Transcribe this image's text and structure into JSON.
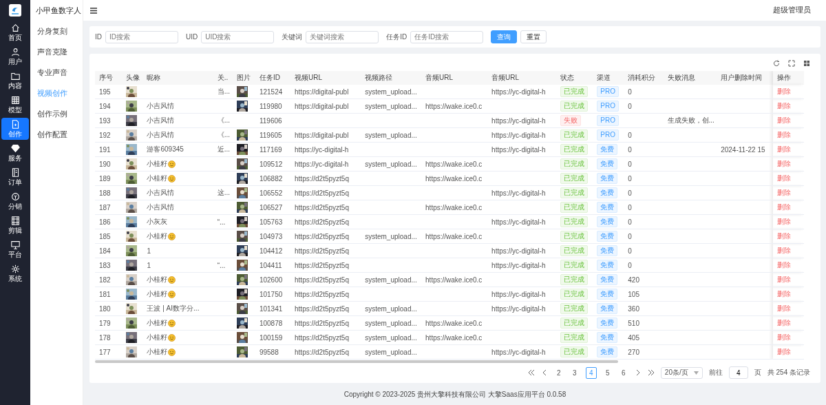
{
  "brand": {
    "title": "小甲鱼数字人"
  },
  "nav": [
    {
      "label": "首页",
      "kind": "home",
      "selected": false
    },
    {
      "label": "用户",
      "kind": "user",
      "selected": false
    },
    {
      "label": "内容",
      "kind": "folder",
      "selected": false
    },
    {
      "label": "模型",
      "kind": "grid",
      "selected": false
    },
    {
      "label": "创作",
      "kind": "doc",
      "selected": true
    },
    {
      "label": "服务",
      "kind": "diamond",
      "selected": false
    },
    {
      "label": "订单",
      "kind": "book",
      "selected": false
    },
    {
      "label": "分销",
      "kind": "coin",
      "selected": false
    },
    {
      "label": "剪辑",
      "kind": "film",
      "selected": false
    },
    {
      "label": "平台",
      "kind": "monitor",
      "selected": false
    },
    {
      "label": "系统",
      "kind": "gear",
      "selected": false
    }
  ],
  "submenu": [
    {
      "label": "分身复刻",
      "selected": false
    },
    {
      "label": "声音克隆",
      "selected": false
    },
    {
      "label": "专业声音",
      "selected": false
    },
    {
      "label": "视频创作",
      "selected": true
    },
    {
      "label": "创作示例",
      "selected": false
    },
    {
      "label": "创作配置",
      "selected": false
    }
  ],
  "user": {
    "name": "超级管理员"
  },
  "filters": [
    {
      "label": "ID",
      "placeholder": "ID搜索"
    },
    {
      "label": "UID",
      "placeholder": "UID搜索"
    },
    {
      "label": "关键词",
      "placeholder": "关键词搜索"
    },
    {
      "label": "任务ID",
      "placeholder": "任务ID搜索"
    }
  ],
  "buttons": [
    {
      "label": "查询",
      "kind": "primary"
    },
    {
      "label": "重置",
      "kind": "plain"
    }
  ],
  "table": {
    "columns": [
      "序号",
      "头像",
      "昵称",
      "关..",
      "图片",
      "任务ID",
      "视频URL",
      "视频路径",
      "音频URL",
      "音频URL",
      "状态",
      "渠道",
      "消耗积分",
      "失败消息",
      "用户删除时间",
      "操作"
    ],
    "rows": [
      {
        "no": "195",
        "nick": "",
        "emoji": false,
        "rel": "当...",
        "image": true,
        "task": "121524",
        "video_url": "https://digital-publ",
        "video_path": "system_upload...",
        "audio_url": "",
        "audio_url_2": "https://yc-digital-h",
        "status": {
          "kind": "done",
          "label": "已完成"
        },
        "channel": "PRO",
        "credits": "0",
        "fail": "",
        "deleted": "",
        "action": "删除"
      },
      {
        "no": "194",
        "nick": "小吉风情",
        "emoji": false,
        "rel": "",
        "image": true,
        "task": "119980",
        "video_url": "https://digital-publ",
        "video_path": "system_upload...",
        "audio_url": "https://wake.ice0.c",
        "audio_url_2": "",
        "status": {
          "kind": "done",
          "label": "已完成"
        },
        "channel": "PRO",
        "credits": "0",
        "fail": "",
        "deleted": "",
        "action": "删除"
      },
      {
        "no": "193",
        "nick": "小吉风情",
        "emoji": false,
        "rel": "《...",
        "image": false,
        "task": "119606",
        "video_url": "",
        "video_path": "",
        "audio_url": "",
        "audio_url_2": "https://yc-digital-h",
        "status": {
          "kind": "failed",
          "label": "失败"
        },
        "channel": "PRO",
        "credits": "",
        "fail": "生成失败，创...",
        "deleted": "",
        "action": "删除"
      },
      {
        "no": "192",
        "nick": "小吉风情",
        "emoji": false,
        "rel": "《...",
        "image": true,
        "task": "119605",
        "video_url": "https://digital-publ",
        "video_path": "system_upload...",
        "audio_url": "",
        "audio_url_2": "https://yc-digital-h",
        "status": {
          "kind": "done",
          "label": "已完成"
        },
        "channel": "PRO",
        "credits": "0",
        "fail": "",
        "deleted": "",
        "action": "删除"
      },
      {
        "no": "191",
        "nick": "游客609345",
        "emoji": false,
        "rel": "近...",
        "image": true,
        "task": "117169",
        "video_url": "https://yc-digital-h",
        "video_path": "",
        "audio_url": "",
        "audio_url_2": "https://yc-digital-h",
        "status": {
          "kind": "done",
          "label": "已完成"
        },
        "channel": "免费",
        "credits": "0",
        "fail": "",
        "deleted": "2024-11-22 15",
        "action": "删除"
      },
      {
        "no": "190",
        "nick": "小桂籽",
        "emoji": true,
        "rel": "",
        "image": true,
        "task": "109512",
        "video_url": "https://yc-digital-h",
        "video_path": "system_upload...",
        "audio_url": "https://wake.ice0.c",
        "audio_url_2": "",
        "status": {
          "kind": "done",
          "label": "已完成"
        },
        "channel": "免费",
        "credits": "0",
        "fail": "",
        "deleted": "",
        "action": "删除"
      },
      {
        "no": "189",
        "nick": "小桂籽",
        "emoji": true,
        "rel": "",
        "image": true,
        "task": "106882",
        "video_url": "https://d2t5pyzt5q",
        "video_path": "",
        "audio_url": "https://wake.ice0.c",
        "audio_url_2": "",
        "status": {
          "kind": "done",
          "label": "已完成"
        },
        "channel": "免费",
        "credits": "0",
        "fail": "",
        "deleted": "",
        "action": "删除"
      },
      {
        "no": "188",
        "nick": "小吉风情",
        "emoji": false,
        "rel": "这...",
        "image": true,
        "task": "106552",
        "video_url": "https://d2t5pyzt5q",
        "video_path": "",
        "audio_url": "",
        "audio_url_2": "https://yc-digital-h",
        "status": {
          "kind": "done",
          "label": "已完成"
        },
        "channel": "免费",
        "credits": "0",
        "fail": "",
        "deleted": "",
        "action": "删除"
      },
      {
        "no": "187",
        "nick": "小吉风情",
        "emoji": false,
        "rel": "",
        "image": true,
        "task": "106527",
        "video_url": "https://d2t5pyzt5q",
        "video_path": "",
        "audio_url": "https://wake.ice0.c",
        "audio_url_2": "",
        "status": {
          "kind": "done",
          "label": "已完成"
        },
        "channel": "免费",
        "credits": "0",
        "fail": "",
        "deleted": "",
        "action": "删除"
      },
      {
        "no": "186",
        "nick": "小灰灰",
        "emoji": false,
        "rel": "“...",
        "image": true,
        "task": "105763",
        "video_url": "https://d2t5pyzt5q",
        "video_path": "",
        "audio_url": "",
        "audio_url_2": "https://yc-digital-h",
        "status": {
          "kind": "done",
          "label": "已完成"
        },
        "channel": "免费",
        "credits": "0",
        "fail": "",
        "deleted": "",
        "action": "删除"
      },
      {
        "no": "185",
        "nick": "小桂籽",
        "emoji": true,
        "rel": "",
        "image": true,
        "task": "104973",
        "video_url": "https://d2t5pyzt5q",
        "video_path": "system_upload...",
        "audio_url": "https://wake.ice0.c",
        "audio_url_2": "",
        "status": {
          "kind": "done",
          "label": "已完成"
        },
        "channel": "免费",
        "credits": "0",
        "fail": "",
        "deleted": "",
        "action": "删除"
      },
      {
        "no": "184",
        "nick": "1",
        "emoji": false,
        "rel": "",
        "image": true,
        "task": "104412",
        "video_url": "https://d2t5pyzt5q",
        "video_path": "",
        "audio_url": "",
        "audio_url_2": "https://yc-digital-h",
        "status": {
          "kind": "done",
          "label": "已完成"
        },
        "channel": "免费",
        "credits": "0",
        "fail": "",
        "deleted": "",
        "action": "删除"
      },
      {
        "no": "183",
        "nick": "1",
        "emoji": false,
        "rel": "“...",
        "image": true,
        "task": "104411",
        "video_url": "https://d2t5pyzt5q",
        "video_path": "",
        "audio_url": "",
        "audio_url_2": "https://yc-digital-h",
        "status": {
          "kind": "done",
          "label": "已完成"
        },
        "channel": "免费",
        "credits": "0",
        "fail": "",
        "deleted": "",
        "action": "删除"
      },
      {
        "no": "182",
        "nick": "小桂籽",
        "emoji": true,
        "rel": "",
        "image": true,
        "task": "102600",
        "video_url": "https://d2t5pyzt5q",
        "video_path": "system_upload...",
        "audio_url": "https://wake.ice0.c",
        "audio_url_2": "",
        "status": {
          "kind": "done",
          "label": "已完成"
        },
        "channel": "免费",
        "credits": "420",
        "fail": "",
        "deleted": "",
        "action": "删除"
      },
      {
        "no": "181",
        "nick": "小桂籽",
        "emoji": true,
        "rel": "",
        "image": true,
        "task": "101750",
        "video_url": "https://d2t5pyzt5q",
        "video_path": "",
        "audio_url": "",
        "audio_url_2": "https://yc-digital-h",
        "status": {
          "kind": "done",
          "label": "已完成"
        },
        "channel": "免费",
        "credits": "105",
        "fail": "",
        "deleted": "",
        "action": "删除"
      },
      {
        "no": "180",
        "nick": "王波 | AI数字分...",
        "emoji": false,
        "rel": "",
        "image": true,
        "task": "101341",
        "video_url": "https://d2t5pyzt5q",
        "video_path": "system_upload...",
        "audio_url": "",
        "audio_url_2": "https://yc-digital-h",
        "status": {
          "kind": "done",
          "label": "已完成"
        },
        "channel": "免费",
        "credits": "360",
        "fail": "",
        "deleted": "",
        "action": "删除"
      },
      {
        "no": "179",
        "nick": "小桂籽",
        "emoji": true,
        "rel": "",
        "image": true,
        "task": "100878",
        "video_url": "https://d2t5pyzt5q",
        "video_path": "system_upload...",
        "audio_url": "https://wake.ice0.c",
        "audio_url_2": "",
        "status": {
          "kind": "done",
          "label": "已完成"
        },
        "channel": "免费",
        "credits": "510",
        "fail": "",
        "deleted": "",
        "action": "删除"
      },
      {
        "no": "178",
        "nick": "小桂籽",
        "emoji": true,
        "rel": "",
        "image": true,
        "task": "100159",
        "video_url": "https://d2t5pyzt5q",
        "video_path": "system_upload...",
        "audio_url": "https://wake.ice0.c",
        "audio_url_2": "",
        "status": {
          "kind": "done",
          "label": "已完成"
        },
        "channel": "免费",
        "credits": "405",
        "fail": "",
        "deleted": "",
        "action": "删除"
      },
      {
        "no": "177",
        "nick": "小桂籽",
        "emoji": true,
        "rel": "",
        "image": true,
        "task": "99588",
        "video_url": "https://d2t5pyzt5q",
        "video_path": "system_upload...",
        "audio_url": "",
        "audio_url_2": "https://yc-digital-h",
        "status": {
          "kind": "done",
          "label": "已完成"
        },
        "channel": "免费",
        "credits": "270",
        "fail": "",
        "deleted": "",
        "action": "删除"
      }
    ]
  },
  "pagination": {
    "pages": [
      {
        "label": "2",
        "selected": false
      },
      {
        "label": "3",
        "selected": false
      },
      {
        "label": "4",
        "selected": true
      },
      {
        "label": "5",
        "selected": false
      },
      {
        "label": "6",
        "selected": false
      }
    ],
    "page_size": "20条/页",
    "goto_label": "前往",
    "goto_value": "4",
    "page_unit": "页",
    "total": "共 254 条记录"
  },
  "footer": "Copyright © 2023-2025 贵州大擎科技有限公司  大擎Saas应用平台 0.0.58"
}
